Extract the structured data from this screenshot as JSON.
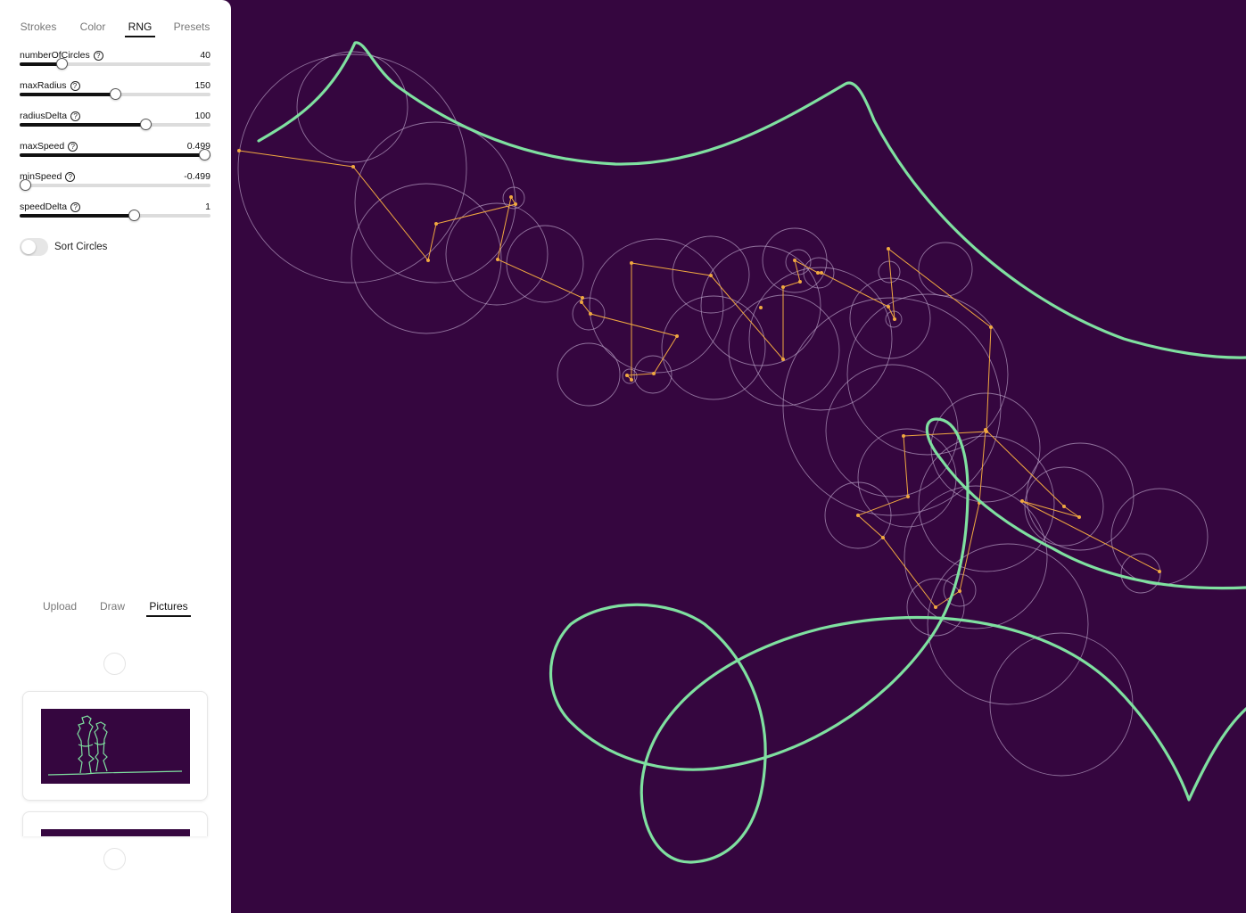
{
  "tabs": [
    "Strokes",
    "Color",
    "RNG",
    "Presets"
  ],
  "active_tab": "RNG",
  "sliders": [
    {
      "label": "numberOfCircles",
      "value": "40",
      "fraction": 0.22
    },
    {
      "label": "maxRadius",
      "value": "150",
      "fraction": 0.5
    },
    {
      "label": "radiusDelta",
      "value": "100",
      "fraction": 0.66
    },
    {
      "label": "maxSpeed",
      "value": "0.499",
      "fraction": 1.0
    },
    {
      "label": "minSpeed",
      "value": "-0.499",
      "fraction": 0.0
    },
    {
      "label": "speedDelta",
      "value": "1",
      "fraction": 0.6
    }
  ],
  "help_glyph": "?",
  "toggle": {
    "label": "Sort Circles",
    "on": false
  },
  "source_tabs": [
    "Upload",
    "Draw",
    "Pictures"
  ],
  "active_source_tab": "Pictures",
  "colors": {
    "background": "#35063f",
    "stroke": "#7fe0a0",
    "arm": "#f0a840",
    "circle": "#b9a1c6"
  }
}
